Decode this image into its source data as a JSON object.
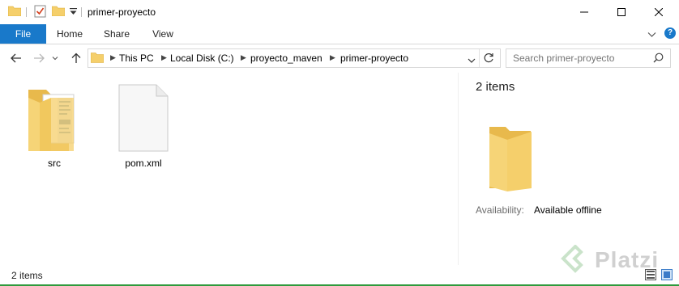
{
  "window": {
    "title": "primer-proyecto",
    "minimize_icon": "minimize-icon",
    "maximize_icon": "maximize-icon",
    "close_icon": "close-icon"
  },
  "ribbon": {
    "tabs": [
      {
        "label": "File"
      },
      {
        "label": "Home"
      },
      {
        "label": "Share"
      },
      {
        "label": "View"
      }
    ]
  },
  "address": {
    "crumbs": [
      "This PC",
      "Local Disk (C:)",
      "proyecto_maven",
      "primer-proyecto"
    ]
  },
  "search": {
    "placeholder": "Search primer-proyecto"
  },
  "files": [
    {
      "name": "src",
      "icon": "folder-icon"
    },
    {
      "name": "pom.xml",
      "icon": "file-icon"
    }
  ],
  "details": {
    "count": "2 items",
    "availability_label": "Availability:",
    "availability_value": "Available offline"
  },
  "status": {
    "text": "2 items"
  },
  "watermark": "Platzi",
  "colors": {
    "accent": "#1979ca",
    "folder": "#f5cf6b",
    "bottom_border": "#2f9a3d"
  }
}
